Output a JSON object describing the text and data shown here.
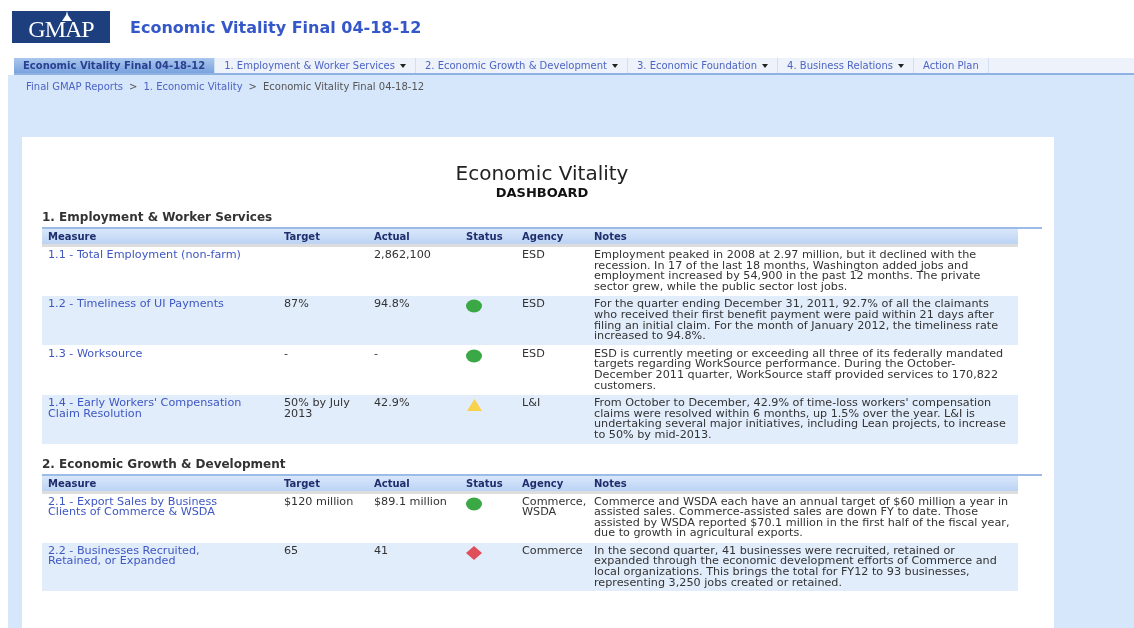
{
  "header": {
    "logo_text": "GMAP",
    "title": "Economic Vitality Final 04-18-12"
  },
  "tabs": [
    {
      "label": "Economic Vitality Final 04-18-12",
      "selected": true,
      "has_menu": false
    },
    {
      "label": "1. Employment & Worker Services",
      "selected": false,
      "has_menu": true
    },
    {
      "label": "2. Economic Growth & Development",
      "selected": false,
      "has_menu": true
    },
    {
      "label": "3. Economic Foundation",
      "selected": false,
      "has_menu": true
    },
    {
      "label": "4. Business Relations",
      "selected": false,
      "has_menu": true
    },
    {
      "label": "Action Plan",
      "selected": false,
      "has_menu": false
    }
  ],
  "breadcrumb": [
    {
      "label": "Final GMAP Reports",
      "link": true
    },
    {
      "label": ">",
      "link": false
    },
    {
      "label": "1. Economic Vitality",
      "link": true
    },
    {
      "label": ">",
      "link": false
    },
    {
      "label": "Economic Vitality Final 04-18-12",
      "link": false
    }
  ],
  "dashboard": {
    "title": "Economic Vitality",
    "subtitle": "DASHBOARD"
  },
  "sections": [
    {
      "heading": "1. Employment & Worker Services",
      "columns": [
        "Measure",
        "Target",
        "Actual",
        "Status",
        "Agency",
        "Notes"
      ],
      "rows": [
        {
          "measure": "1.1 - Total Employment (non-farm)",
          "actual": "2,862,100",
          "agency": "ESD",
          "notes": "Employment peaked in 2008 at 2.97 million, but it declined with the recession. In 17 of the last 18 months, Washington added jobs and employment increased by 54,900 in the past 12 months. The private sector grew, while the public sector lost jobs."
        },
        {
          "measure": "1.2 - Timeliness of UI Payments",
          "target": "87%",
          "actual": "94.8%",
          "status": {
            "kind": "dot",
            "color": "#3aa845"
          },
          "agency": "ESD",
          "notes": "For the quarter ending December 31, 2011, 92.7% of all the claimants who received their first benefit payment were paid within 21 days after filing an initial claim. For the month of January 2012, the timeliness rate increased to 94.8%."
        },
        {
          "measure": "1.3 - Worksource",
          "target": "-",
          "actual": "-",
          "status": {
            "kind": "dot",
            "color": "#3aa845"
          },
          "agency": "ESD",
          "notes": "ESD is currently meeting or exceeding all three of its federally mandated targets regarding WorkSource performance. During the October-December 2011 quarter, WorkSource staff provided services to 170,822 customers."
        },
        {
          "measure": "1.4 - Early Workers' Compensation Claim Resolution",
          "target": "50% by July 2013",
          "actual": "42.9%",
          "status": {
            "kind": "triangle",
            "color": "#f7d24a"
          },
          "agency": "L&I",
          "notes": "From October to December, 42.9% of time-loss workers' compensation claims were resolved within 6 months, up 1.5% over the year. L&I is undertaking several major initiatives, including Lean projects, to increase to 50% by mid-2013."
        }
      ]
    },
    {
      "heading": "2. Economic Growth & Development",
      "columns": [
        "Measure",
        "Target",
        "Actual",
        "Status",
        "Agency",
        "Notes"
      ],
      "rows": [
        {
          "measure": "2.1 - Export Sales by Business Clients of Commerce & WSDA",
          "target": "$120 million",
          "actual": "$89.1 million",
          "status": {
            "kind": "dot",
            "color": "#3aa845"
          },
          "agency": "Commerce, WSDA",
          "notes": "Commerce and WSDA each have an annual target of $60 million a year in assisted sales. Commerce-assisted sales are down FY to date. Those assisted by WSDA reported $70.1 million in the first half of the fiscal year, due to growth in agricultural exports."
        },
        {
          "measure": "2.2 - Businesses Recruited, Retained, or Expanded",
          "target": "65",
          "actual": "41",
          "status": {
            "kind": "diamond",
            "color": "#e0505a"
          },
          "agency": "Commerce",
          "notes": "In the second quarter, 41 businesses were recruited, retained or expanded through the economic development efforts of Commerce and local organizations. This brings the total for FY12 to 93 businesses, representing 3,250 jobs created or retained."
        }
      ]
    }
  ]
}
